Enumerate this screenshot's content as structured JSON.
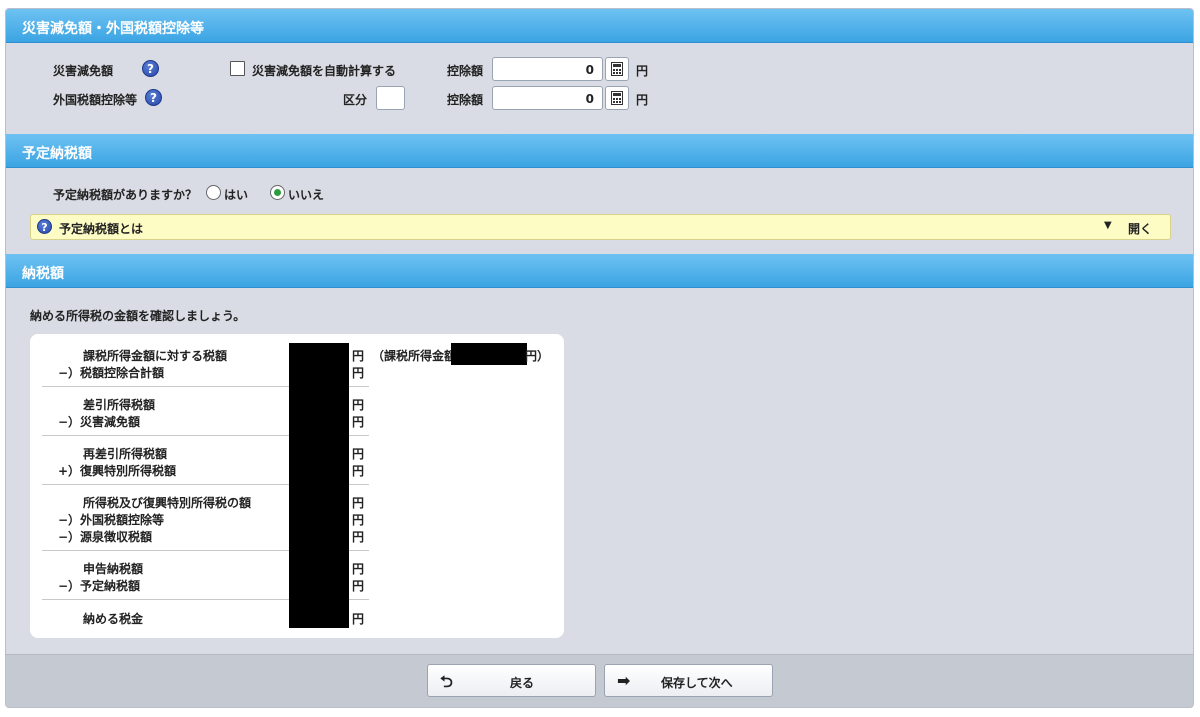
{
  "disaster": {
    "header": "災害減免額・外国税額控除等",
    "disaster_label": "災害減免額",
    "auto_calc_label": "災害減免額を自動計算する",
    "deduction_label": "控除額",
    "amount1": "0",
    "yen": "円",
    "foreign_label": "外国税額控除等",
    "category_label": "区分",
    "amount2": "0"
  },
  "prepaid": {
    "header": "予定納税額",
    "question": "予定納税額がありますか？",
    "yes": "はい",
    "no": "いいえ",
    "selected": "no",
    "info_text": "予定納税額とは",
    "open_label": "開く"
  },
  "tax": {
    "header": "納税額",
    "intro": "納める所得税の金額を確認しましょう。",
    "yen": "円",
    "taxable_note_open": "（課税所得金額",
    "taxable_note_close": "円）",
    "rows": [
      "課税所得金額に対する税額",
      "−）税額控除合計額",
      "差引所得税額",
      "−）災害減免額",
      "再差引所得税額",
      "+）復興特別所得税額",
      "所得税及び復興特別所得税の額",
      "−）外国税額控除等",
      "−）源泉徴収税額",
      "申告納税額",
      "−）予定納税額",
      "納める税金"
    ]
  },
  "footer": {
    "back_label": "戻る",
    "next_label": "保存して次へ"
  },
  "colors": {
    "header_blue": "#3ba4e3",
    "panel_gray": "#d9dce4",
    "info_yellow": "#fdfcc5",
    "radio_green": "#2a9d3f"
  }
}
